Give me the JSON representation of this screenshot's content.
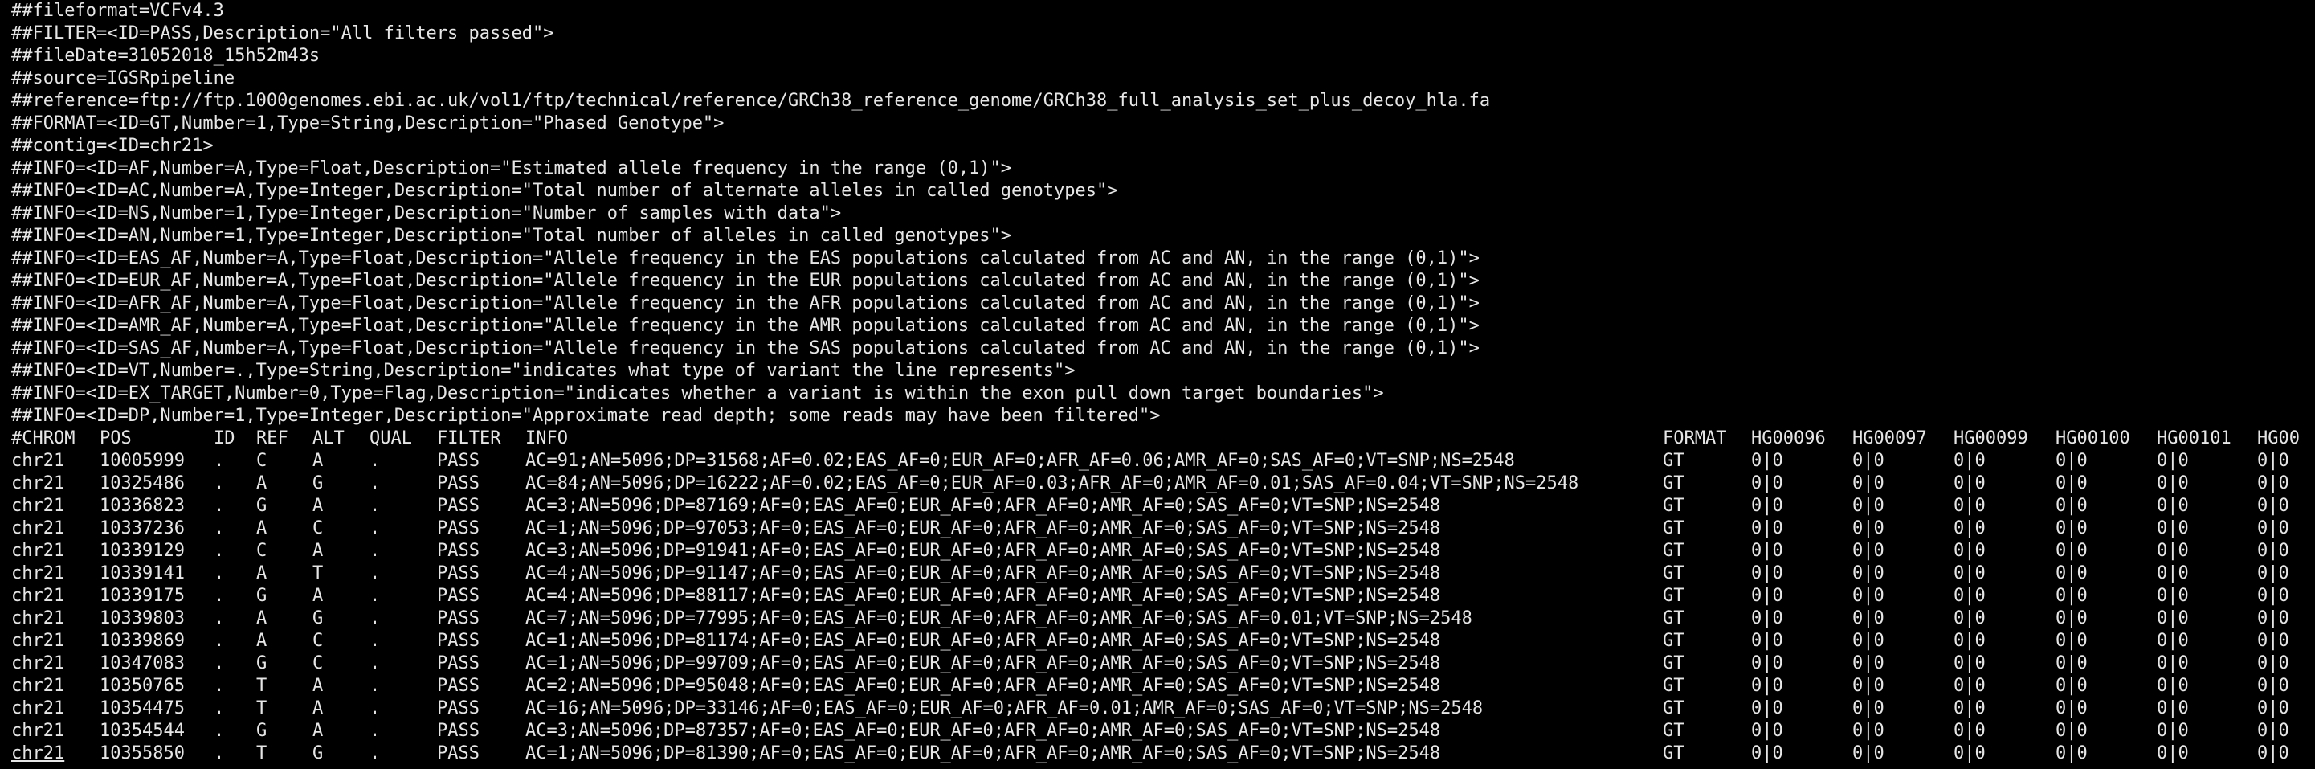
{
  "terminal": {
    "header_lines": [
      "##fileformat=VCFv4.3",
      "##FILTER=<ID=PASS,Description=\"All filters passed\">",
      "##fileDate=31052018_15h52m43s",
      "##source=IGSRpipeline",
      "##reference=ftp://ftp.1000genomes.ebi.ac.uk/vol1/ftp/technical/reference/GRCh38_reference_genome/GRCh38_full_analysis_set_plus_decoy_hla.fa",
      "##FORMAT=<ID=GT,Number=1,Type=String,Description=\"Phased Genotype\">",
      "##contig=<ID=chr21>",
      "##INFO=<ID=AF,Number=A,Type=Float,Description=\"Estimated allele frequency in the range (0,1)\">",
      "##INFO=<ID=AC,Number=A,Type=Integer,Description=\"Total number of alternate alleles in called genotypes\">",
      "##INFO=<ID=NS,Number=1,Type=Integer,Description=\"Number of samples with data\">",
      "##INFO=<ID=AN,Number=1,Type=Integer,Description=\"Total number of alleles in called genotypes\">",
      "##INFO=<ID=EAS_AF,Number=A,Type=Float,Description=\"Allele frequency in the EAS populations calculated from AC and AN, in the range (0,1)\">",
      "##INFO=<ID=EUR_AF,Number=A,Type=Float,Description=\"Allele frequency in the EUR populations calculated from AC and AN, in the range (0,1)\">",
      "##INFO=<ID=AFR_AF,Number=A,Type=Float,Description=\"Allele frequency in the AFR populations calculated from AC and AN, in the range (0,1)\">",
      "##INFO=<ID=AMR_AF,Number=A,Type=Float,Description=\"Allele frequency in the AMR populations calculated from AC and AN, in the range (0,1)\">",
      "##INFO=<ID=SAS_AF,Number=A,Type=Float,Description=\"Allele frequency in the SAS populations calculated from AC and AN, in the range (0,1)\">",
      "##INFO=<ID=VT,Number=.,Type=String,Description=\"indicates what type of variant the line represents\">",
      "##INFO=<ID=EX_TARGET,Number=0,Type=Flag,Description=\"indicates whether a variant is within the exon pull down target boundaries\">",
      "##INFO=<ID=DP,Number=1,Type=Integer,Description=\"Approximate read depth; some reads may have been filtered\">"
    ],
    "columns": [
      "#CHROM",
      "POS",
      "ID",
      "REF",
      "ALT",
      "QUAL",
      "FILTER",
      "INFO",
      "FORMAT",
      "HG00096",
      "HG00097",
      "HG00099",
      "HG00100",
      "HG00101",
      "HG00"
    ],
    "rows": [
      [
        "chr21",
        "10005999",
        ".",
        "C",
        "A",
        ".",
        "PASS",
        "AC=91;AN=5096;DP=31568;AF=0.02;EAS_AF=0;EUR_AF=0;AFR_AF=0.06;AMR_AF=0;SAS_AF=0;VT=SNP;NS=2548",
        "GT",
        "0|0",
        "0|0",
        "0|0",
        "0|0",
        "0|0",
        "0|0"
      ],
      [
        "chr21",
        "10325486",
        ".",
        "A",
        "G",
        ".",
        "PASS",
        "AC=84;AN=5096;DP=16222;AF=0.02;EAS_AF=0;EUR_AF=0.03;AFR_AF=0;AMR_AF=0.01;SAS_AF=0.04;VT=SNP;NS=2548",
        "GT",
        "0|0",
        "0|0",
        "0|0",
        "0|0",
        "0|0",
        "0|0"
      ],
      [
        "chr21",
        "10336823",
        ".",
        "G",
        "A",
        ".",
        "PASS",
        "AC=3;AN=5096;DP=87169;AF=0;EAS_AF=0;EUR_AF=0;AFR_AF=0;AMR_AF=0;SAS_AF=0;VT=SNP;NS=2548",
        "GT",
        "0|0",
        "0|0",
        "0|0",
        "0|0",
        "0|0",
        "0|0"
      ],
      [
        "chr21",
        "10337236",
        ".",
        "A",
        "C",
        ".",
        "PASS",
        "AC=1;AN=5096;DP=97053;AF=0;EAS_AF=0;EUR_AF=0;AFR_AF=0;AMR_AF=0;SAS_AF=0;VT=SNP;NS=2548",
        "GT",
        "0|0",
        "0|0",
        "0|0",
        "0|0",
        "0|0",
        "0|0"
      ],
      [
        "chr21",
        "10339129",
        ".",
        "C",
        "A",
        ".",
        "PASS",
        "AC=3;AN=5096;DP=91941;AF=0;EAS_AF=0;EUR_AF=0;AFR_AF=0;AMR_AF=0;SAS_AF=0;VT=SNP;NS=2548",
        "GT",
        "0|0",
        "0|0",
        "0|0",
        "0|0",
        "0|0",
        "0|0"
      ],
      [
        "chr21",
        "10339141",
        ".",
        "A",
        "T",
        ".",
        "PASS",
        "AC=4;AN=5096;DP=91147;AF=0;EAS_AF=0;EUR_AF=0;AFR_AF=0;AMR_AF=0;SAS_AF=0;VT=SNP;NS=2548",
        "GT",
        "0|0",
        "0|0",
        "0|0",
        "0|0",
        "0|0",
        "0|0"
      ],
      [
        "chr21",
        "10339175",
        ".",
        "G",
        "A",
        ".",
        "PASS",
        "AC=4;AN=5096;DP=88117;AF=0;EAS_AF=0;EUR_AF=0;AFR_AF=0;AMR_AF=0;SAS_AF=0;VT=SNP;NS=2548",
        "GT",
        "0|0",
        "0|0",
        "0|0",
        "0|0",
        "0|0",
        "0|0"
      ],
      [
        "chr21",
        "10339803",
        ".",
        "A",
        "G",
        ".",
        "PASS",
        "AC=7;AN=5096;DP=77995;AF=0;EAS_AF=0;EUR_AF=0;AFR_AF=0;AMR_AF=0;SAS_AF=0.01;VT=SNP;NS=2548",
        "GT",
        "0|0",
        "0|0",
        "0|0",
        "0|0",
        "0|0",
        "0|0"
      ],
      [
        "chr21",
        "10339869",
        ".",
        "A",
        "C",
        ".",
        "PASS",
        "AC=1;AN=5096;DP=81174;AF=0;EAS_AF=0;EUR_AF=0;AFR_AF=0;AMR_AF=0;SAS_AF=0;VT=SNP;NS=2548",
        "GT",
        "0|0",
        "0|0",
        "0|0",
        "0|0",
        "0|0",
        "0|0"
      ],
      [
        "chr21",
        "10347083",
        ".",
        "G",
        "C",
        ".",
        "PASS",
        "AC=1;AN=5096;DP=99709;AF=0;EAS_AF=0;EUR_AF=0;AFR_AF=0;AMR_AF=0;SAS_AF=0;VT=SNP;NS=2548",
        "GT",
        "0|0",
        "0|0",
        "0|0",
        "0|0",
        "0|0",
        "0|0"
      ],
      [
        "chr21",
        "10350765",
        ".",
        "T",
        "A",
        ".",
        "PASS",
        "AC=2;AN=5096;DP=95048;AF=0;EAS_AF=0;EUR_AF=0;AFR_AF=0;AMR_AF=0;SAS_AF=0;VT=SNP;NS=2548",
        "GT",
        "0|0",
        "0|0",
        "0|0",
        "0|0",
        "0|0",
        "0|0"
      ],
      [
        "chr21",
        "10354475",
        ".",
        "T",
        "A",
        ".",
        "PASS",
        "AC=16;AN=5096;DP=33146;AF=0;EAS_AF=0;EUR_AF=0;AFR_AF=0.01;AMR_AF=0;SAS_AF=0;VT=SNP;NS=2548",
        "GT",
        "0|0",
        "0|0",
        "0|0",
        "0|0",
        "0|0",
        "0|0"
      ],
      [
        "chr21",
        "10354544",
        ".",
        "G",
        "A",
        ".",
        "PASS",
        "AC=3;AN=5096;DP=87357;AF=0;EAS_AF=0;EUR_AF=0;AFR_AF=0;AMR_AF=0;SAS_AF=0;VT=SNP;NS=2548",
        "GT",
        "0|0",
        "0|0",
        "0|0",
        "0|0",
        "0|0",
        "0|0"
      ],
      [
        "chr21",
        "10355850",
        ".",
        "T",
        "G",
        ".",
        "PASS",
        "AC=1;AN=5096;DP=81390;AF=0;EAS_AF=0;EUR_AF=0;AFR_AF=0;AMR_AF=0;SAS_AF=0;VT=SNP;NS=2548",
        "GT",
        "0|0",
        "0|0",
        "0|0",
        "0|0",
        "0|0",
        "0|0"
      ]
    ]
  }
}
